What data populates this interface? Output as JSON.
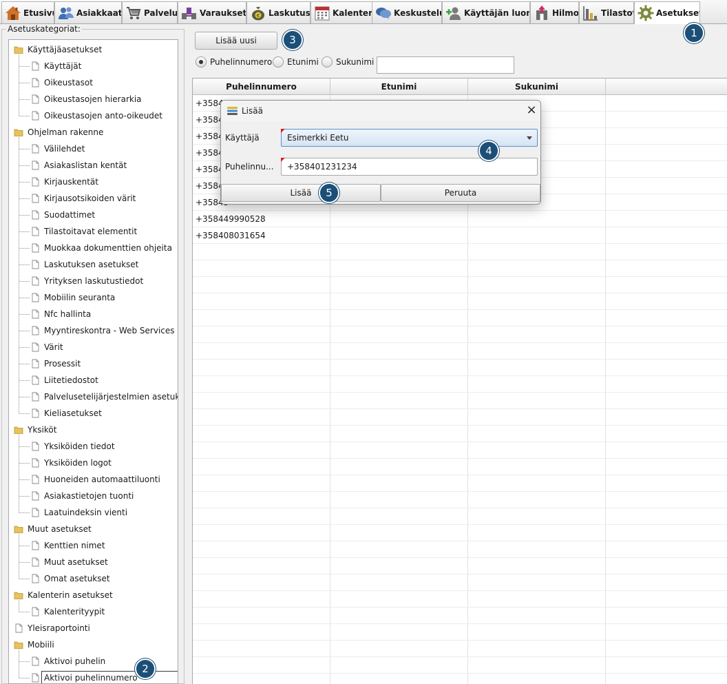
{
  "tabs": [
    {
      "key": "etusivu",
      "label": "Etusivu",
      "icon": "home-icon"
    },
    {
      "key": "asiakkaat",
      "label": "Asiakkaat",
      "icon": "users-icon"
    },
    {
      "key": "palvelut",
      "label": "Palvelut",
      "icon": "cart-icon"
    },
    {
      "key": "varaukset",
      "label": "Varaukset",
      "icon": "reservations-icon"
    },
    {
      "key": "laskutus",
      "label": "Laskutus",
      "icon": "money-bag-icon"
    },
    {
      "key": "kalenteri",
      "label": "Kalenteri",
      "icon": "calendar-icon"
    },
    {
      "key": "keskustelu",
      "label": "Keskustelu",
      "icon": "chat-icon"
    },
    {
      "key": "kayttajan-luonti",
      "label": "Käyttäjän luonti",
      "icon": "add-user-icon"
    },
    {
      "key": "hilmo",
      "label": "Hilmo",
      "icon": "hilmo-icon"
    },
    {
      "key": "tilastot",
      "label": "Tilastot",
      "icon": "bar-chart-icon"
    },
    {
      "key": "asetukset",
      "label": "Asetukset",
      "icon": "gear-icon",
      "active": true
    }
  ],
  "sidebar": {
    "group_label": "Asetuskategoriat:",
    "tree": [
      {
        "label": "Käyttäjäasetukset",
        "type": "folder",
        "level": 0
      },
      {
        "label": "Käyttäjät",
        "type": "page",
        "level": 1
      },
      {
        "label": "Oikeustasot",
        "type": "page",
        "level": 1
      },
      {
        "label": "Oikeustasojen hierarkia",
        "type": "page",
        "level": 1
      },
      {
        "label": "Oikeustasojen anto-oikeudet",
        "type": "page",
        "level": 1
      },
      {
        "label": "Ohjelman rakenne",
        "type": "folder",
        "level": 0
      },
      {
        "label": "Välilehdet",
        "type": "page",
        "level": 1
      },
      {
        "label": "Asiakaslistan kentät",
        "type": "page",
        "level": 1
      },
      {
        "label": "Kirjauskentät",
        "type": "page",
        "level": 1
      },
      {
        "label": "Kirjausotsikoiden värit",
        "type": "page",
        "level": 1
      },
      {
        "label": "Suodattimet",
        "type": "page",
        "level": 1
      },
      {
        "label": "Tilastoitavat elementit",
        "type": "page",
        "level": 1
      },
      {
        "label": "Muokkaa dokumenttien ohjeita",
        "type": "page",
        "level": 1
      },
      {
        "label": "Laskutuksen asetukset",
        "type": "page",
        "level": 1
      },
      {
        "label": "Yrityksen laskutustiedot",
        "type": "page",
        "level": 1
      },
      {
        "label": "Mobiilin seuranta",
        "type": "page",
        "level": 1
      },
      {
        "label": "Nfc hallinta",
        "type": "page",
        "level": 1
      },
      {
        "label": "Myyntireskontra - Web Services",
        "type": "page",
        "level": 1
      },
      {
        "label": "Värit",
        "type": "page",
        "level": 1
      },
      {
        "label": "Prosessit",
        "type": "page",
        "level": 1
      },
      {
        "label": "Liitetiedostot",
        "type": "page",
        "level": 1
      },
      {
        "label": "Palvelusetelijärjestelmien asetukset",
        "type": "page",
        "level": 1
      },
      {
        "label": "Kieliasetukset",
        "type": "page",
        "level": 1
      },
      {
        "label": "Yksiköt",
        "type": "folder",
        "level": 0
      },
      {
        "label": "Yksiköiden tiedot",
        "type": "page",
        "level": 1
      },
      {
        "label": "Yksiköiden logot",
        "type": "page",
        "level": 1
      },
      {
        "label": "Huoneiden automaattiluonti",
        "type": "page",
        "level": 1
      },
      {
        "label": "Asiakastietojen tuonti",
        "type": "page",
        "level": 1
      },
      {
        "label": "Laatuindeksin vienti",
        "type": "page",
        "level": 1
      },
      {
        "label": "Muut asetukset",
        "type": "folder",
        "level": 0
      },
      {
        "label": "Kenttien nimet",
        "type": "page",
        "level": 1
      },
      {
        "label": "Muut asetukset",
        "type": "page",
        "level": 1
      },
      {
        "label": "Omat asetukset",
        "type": "page",
        "level": 1
      },
      {
        "label": "Kalenterin asetukset",
        "type": "folder",
        "level": 0
      },
      {
        "label": "Kalenterityypit",
        "type": "page",
        "level": 1
      },
      {
        "label": "Yleisraportointi",
        "type": "page",
        "level": 0
      },
      {
        "label": "Mobiili",
        "type": "folder",
        "level": 0
      },
      {
        "label": "Aktivoi puhelin",
        "type": "page",
        "level": 1
      },
      {
        "label": "Aktivoi puhelinnumero",
        "type": "page",
        "level": 1,
        "selected": true
      }
    ]
  },
  "toolbar": {
    "add_new_label": "Lisää uusi"
  },
  "search": {
    "options": [
      {
        "label": "Puhelinnumero",
        "selected": true
      },
      {
        "label": "Etunimi",
        "selected": false
      },
      {
        "label": "Sukunimi",
        "selected": false
      }
    ],
    "value": ""
  },
  "table": {
    "columns": [
      "Puhelinnumero",
      "Etunimi",
      "Sukunimi"
    ],
    "rows": [
      [
        "+35844",
        "",
        ""
      ],
      [
        "+35840",
        "",
        ""
      ],
      [
        "+35840",
        "",
        ""
      ],
      [
        "+35845",
        "",
        ""
      ],
      [
        "+35840",
        "",
        ""
      ],
      [
        "+35840",
        "",
        ""
      ],
      [
        "+35845",
        "",
        ""
      ],
      [
        "+358449990528",
        "",
        ""
      ],
      [
        "+358408031654",
        "",
        ""
      ]
    ],
    "total_visible_rows": 36
  },
  "dialog": {
    "title": "Lisää",
    "user_label": "Käyttäjä",
    "user_value": "Esimerkki Eetu",
    "phone_label": "Puhelinnu...",
    "phone_value": "+358401231234",
    "ok_label": "Lisää",
    "cancel_label": "Peruuta"
  },
  "callouts": [
    "1",
    "2",
    "3",
    "4",
    "5"
  ],
  "colors": {
    "badge": "#1b4f77",
    "required_marker": "#d42020",
    "select_focus": "#5b8fc9"
  }
}
